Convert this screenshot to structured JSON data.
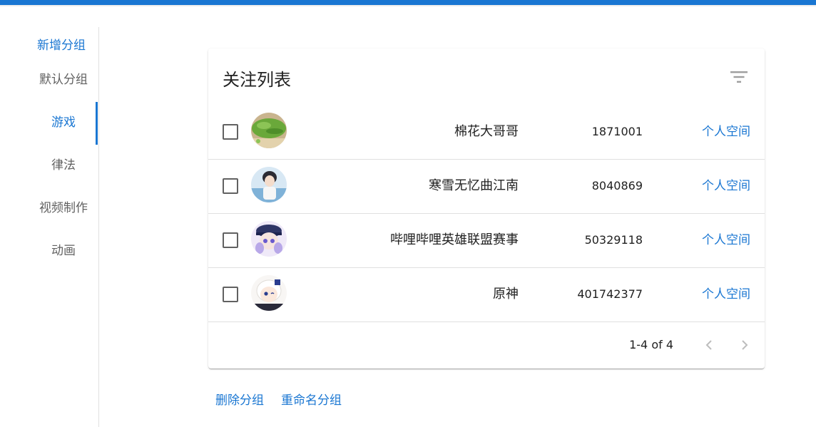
{
  "sidebar": {
    "add_label": "新增分组",
    "items": [
      {
        "label": "默认分组"
      },
      {
        "label": "游戏"
      },
      {
        "label": "律法"
      },
      {
        "label": "视频制作"
      },
      {
        "label": "动画"
      }
    ],
    "active_index": 1
  },
  "card": {
    "title": "关注列表",
    "filter_icon": "filter-list-icon",
    "rows": [
      {
        "name": "棉花大哥哥",
        "uid": "1871001",
        "link": "个人空间",
        "avatar": "green-vegetable-photo"
      },
      {
        "name": "寒雪无忆曲江南",
        "uid": "8040869",
        "link": "个人空间",
        "avatar": "anime-boy-portrait"
      },
      {
        "name": "哔哩哔哩英雄联盟赛事",
        "uid": "50329118",
        "link": "个人空间",
        "avatar": "anime-police-girl"
      },
      {
        "name": "原神",
        "uid": "401742377",
        "link": "个人空间",
        "avatar": "paimon-portrait"
      }
    ],
    "pagination": {
      "text": "1-4 of 4",
      "prev_icon": "chevron-left-icon",
      "next_icon": "chevron-right-icon"
    }
  },
  "actions": {
    "delete_group": "删除分组",
    "rename_group": "重命名分组"
  },
  "colors": {
    "accent": "#1976d2",
    "text": "#212121",
    "muted": "#616161"
  }
}
